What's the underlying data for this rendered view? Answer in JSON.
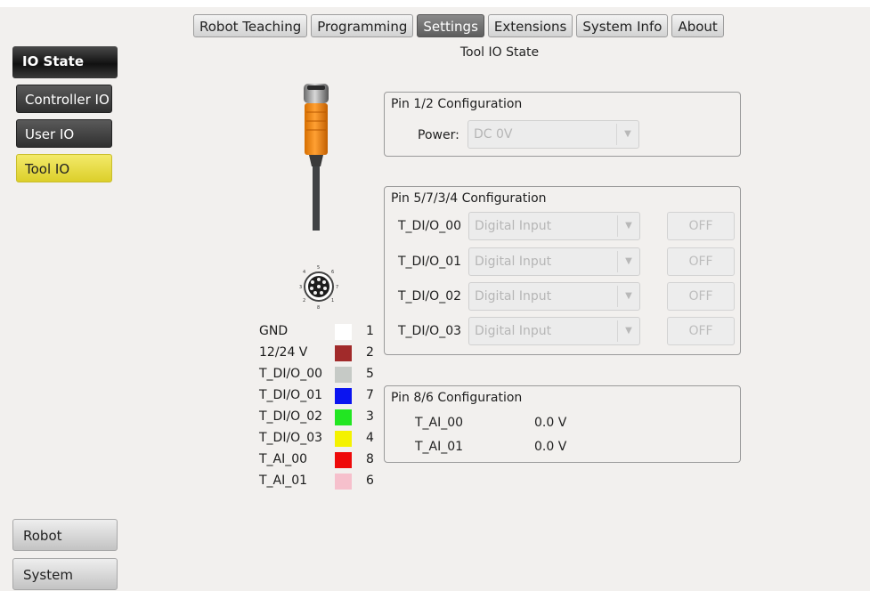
{
  "tabs": [
    {
      "label": "Robot Teaching"
    },
    {
      "label": "Programming"
    },
    {
      "label": "Settings",
      "active": true
    },
    {
      "label": "Extensions"
    },
    {
      "label": "System Info"
    },
    {
      "label": "About"
    }
  ],
  "page_title": "Tool IO State",
  "sidebar": {
    "header": "IO State",
    "items": [
      {
        "label": "Controller IO"
      },
      {
        "label": "User IO"
      },
      {
        "label": "Tool IO",
        "selected": true
      }
    ],
    "bottom": [
      {
        "label": "Robot"
      },
      {
        "label": "System"
      }
    ]
  },
  "connector_pin_numbers": [
    "1",
    "2",
    "3",
    "4",
    "5",
    "6",
    "7",
    "8"
  ],
  "legend": [
    {
      "name": "GND",
      "color": "#ffffff",
      "pin": "1"
    },
    {
      "name": "12/24 V",
      "color": "#a12a2a",
      "pin": "2"
    },
    {
      "name": "T_DI/O_00",
      "color": "#c6cac6",
      "pin": "5"
    },
    {
      "name": "T_DI/O_01",
      "color": "#0a14f0",
      "pin": "7"
    },
    {
      "name": "T_DI/O_02",
      "color": "#22e622",
      "pin": "3"
    },
    {
      "name": "T_DI/O_03",
      "color": "#f4f200",
      "pin": "4"
    },
    {
      "name": "T_AI_00",
      "color": "#ee0a0a",
      "pin": "8"
    },
    {
      "name": "T_AI_01",
      "color": "#f6c0cc",
      "pin": "6"
    }
  ],
  "pin12": {
    "title": "Pin 1/2 Configuration",
    "power_label": "Power:",
    "power_value": "DC 0V"
  },
  "pin5734": {
    "title": "Pin 5/7/3/4  Configuration",
    "rows": [
      {
        "label": "T_DI/O_00",
        "mode": "Digital Input",
        "state": "OFF"
      },
      {
        "label": "T_DI/O_01",
        "mode": "Digital Input",
        "state": "OFF"
      },
      {
        "label": "T_DI/O_02",
        "mode": "Digital Input",
        "state": "OFF"
      },
      {
        "label": "T_DI/O_03",
        "mode": "Digital Input",
        "state": "OFF"
      }
    ]
  },
  "pin86": {
    "title": "Pin 8/6 Configuration",
    "rows": [
      {
        "label": "T_AI_00",
        "value": "0.0 V"
      },
      {
        "label": "T_AI_01",
        "value": "0.0 V"
      }
    ]
  },
  "icons": {
    "dropdown": "chevron-down-icon",
    "cable": "cable-connector-icon",
    "pinout": "pin-layout-icon"
  }
}
